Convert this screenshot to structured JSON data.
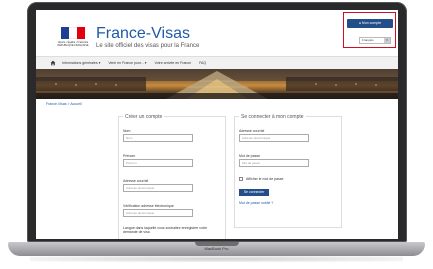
{
  "header": {
    "logo_text": "Liberté • Égalité • Fraternité RÉPUBLIQUE FRANÇAISE",
    "title": "France-Visas",
    "subtitle": "Le site officiel des visas pour la France",
    "account_button": "Mon compte",
    "language": "Français",
    "flag_colors": [
      "#1f3f95",
      "#ffffff",
      "#e1000f"
    ]
  },
  "nav": {
    "home_icon": "home-icon",
    "items": [
      "Informations générales",
      "Venir en France pour...",
      "Votre arrivée en France",
      "FAQ"
    ]
  },
  "breadcrumb": "France-Visas > Accueil",
  "register": {
    "title": "Créer un compte",
    "fields": [
      {
        "label": "Nom",
        "placeholder": "Nom"
      },
      {
        "label": "Prénom",
        "placeholder": "Prénom"
      },
      {
        "label": "Adresse courriel",
        "placeholder": "Adresse électronique"
      },
      {
        "label": "Vérification adresse électronique",
        "placeholder": "Adresse électronique"
      }
    ],
    "language_label": "Langue dans laquelle vous souhaitez enregistrer votre demande de visa"
  },
  "login": {
    "title": "Se connecter à mon compte",
    "email_label": "Adresse courriel",
    "email_placeholder": "Adresse électronique",
    "password_label": "Mot de passe",
    "password_placeholder": "Mot de passe",
    "show_password": "Afficher le mot de passe",
    "login_button": "Se connecter",
    "forgot_link": "Mot de passe oublié ?"
  },
  "device": {
    "label": "MacBook Pro"
  },
  "colors": {
    "brand_blue": "#1f5aa6",
    "button_blue": "#244e8a",
    "highlight_red": "#d0101e"
  }
}
